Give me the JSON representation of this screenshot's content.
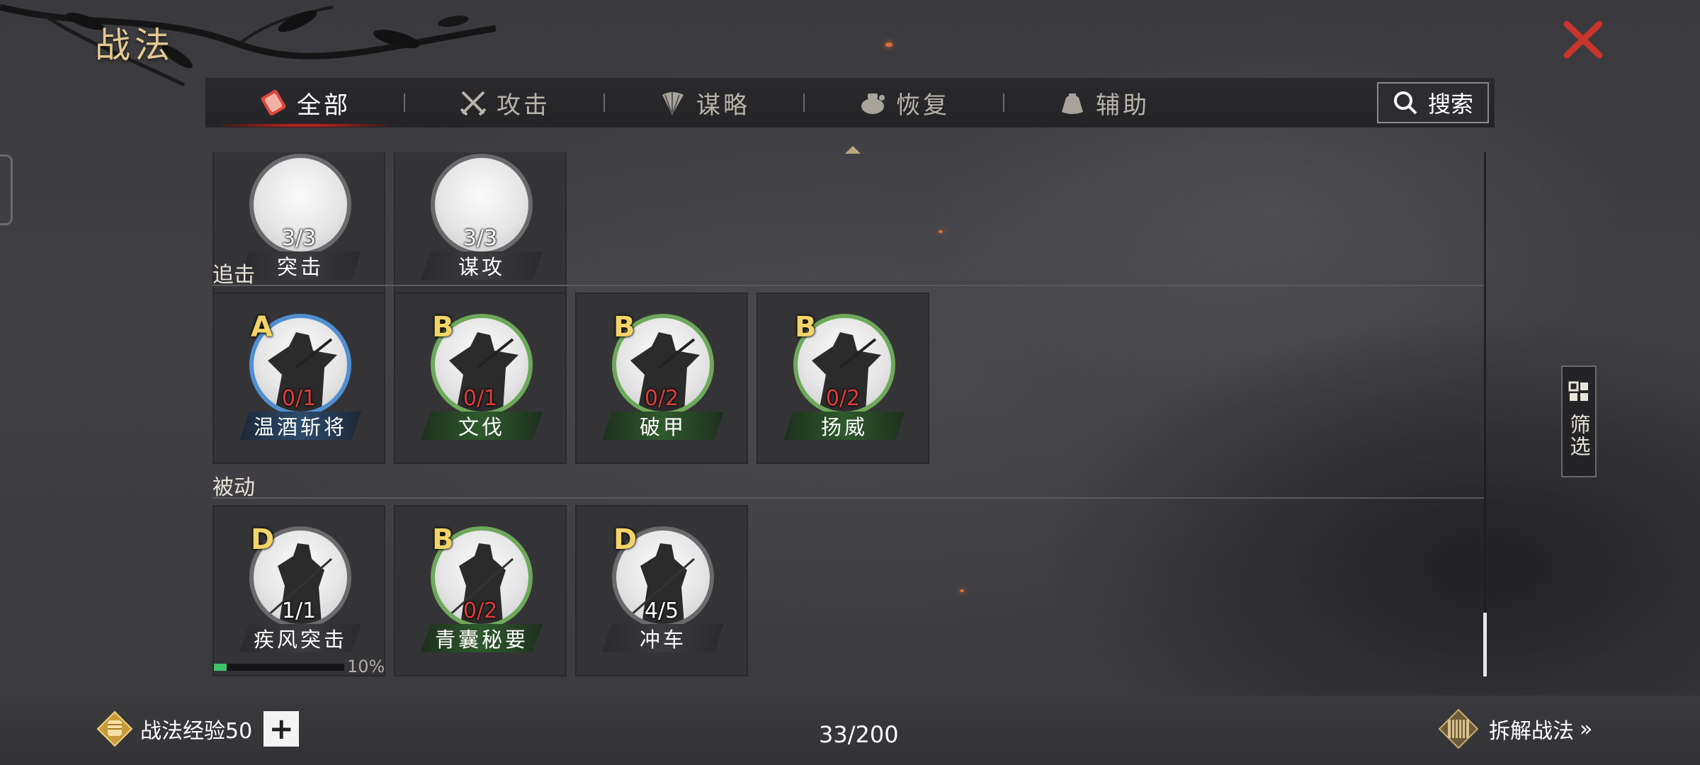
{
  "header": {
    "title": "战法"
  },
  "tabs": [
    {
      "label": "全部",
      "icon": "all-scroll-icon",
      "active": true
    },
    {
      "label": "攻击",
      "icon": "crossed-swords-icon",
      "active": false
    },
    {
      "label": "谋略",
      "icon": "strategy-fan-icon",
      "active": false
    },
    {
      "label": "恢复",
      "icon": "recover-pot-icon",
      "active": false
    },
    {
      "label": "辅助",
      "icon": "support-bag-icon",
      "active": false
    }
  ],
  "search": {
    "label": "搜索"
  },
  "filter": {
    "label": "筛选"
  },
  "sections": {
    "top_cards": [
      {
        "name": "突击",
        "count": "3/3",
        "plate": "gray"
      },
      {
        "name": "谋攻",
        "count": "3/3",
        "plate": "gray"
      }
    ],
    "pursuit": {
      "label": "追击",
      "cards": [
        {
          "grade": "A",
          "name": "温酒斩将",
          "count": "0/1",
          "quality": "blue"
        },
        {
          "grade": "B",
          "name": "文伐",
          "count": "0/1",
          "quality": "green"
        },
        {
          "grade": "B",
          "name": "破甲",
          "count": "0/2",
          "quality": "green"
        },
        {
          "grade": "B",
          "name": "扬威",
          "count": "0/2",
          "quality": "green"
        }
      ]
    },
    "passive": {
      "label": "被动",
      "cards": [
        {
          "grade": "D",
          "name": "疾风突击",
          "count": "1/1",
          "quality": "gray",
          "progress": 0.1,
          "progress_label": "10%"
        },
        {
          "grade": "B",
          "name": "青囊秘要",
          "count": "0/2",
          "quality": "green"
        },
        {
          "grade": "D",
          "name": "冲车",
          "count": "4/5",
          "quality": "gray"
        }
      ]
    }
  },
  "bottom": {
    "exp_label": "战法经验50",
    "plus": "+",
    "capacity": "33/200",
    "decompose_label": "拆解战法",
    "decompose_chevron": "»"
  },
  "colors": {
    "accent_gold": "#e2c98e",
    "close_red": "#c8352d",
    "quality_green": "#6ea85a",
    "quality_blue": "#4f8fd0",
    "count_red": "#e23c3c",
    "progress_green": "#3ec16a"
  }
}
